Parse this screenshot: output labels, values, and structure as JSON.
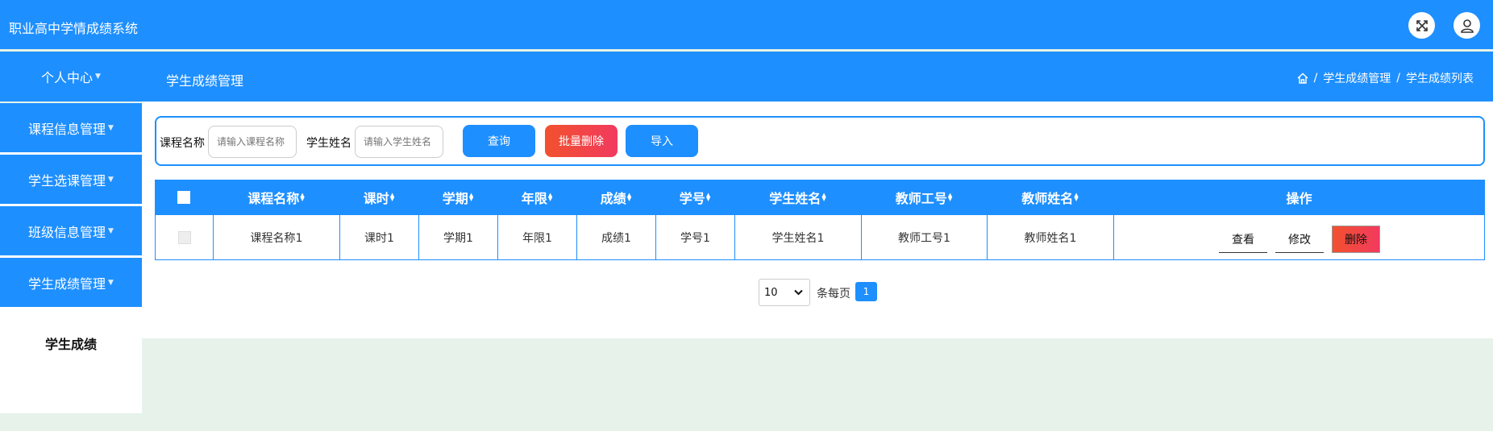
{
  "app": {
    "title": "职业高中学情成绩系统"
  },
  "header": {
    "expand_icon": "expand-arrows-icon",
    "user_icon": "user-icon"
  },
  "subbar": {
    "personal_center": "个人中心",
    "page_title": "学生成绩管理",
    "breadcrumb": [
      "学生成绩管理",
      "学生成绩列表"
    ]
  },
  "sidebar": {
    "items": [
      {
        "label": "课程信息管理"
      },
      {
        "label": "学生选课管理"
      },
      {
        "label": "班级信息管理"
      },
      {
        "label": "学生成绩管理"
      }
    ],
    "active_sub": "学生成绩"
  },
  "search": {
    "course_label": "课程名称",
    "course_placeholder": "请输入课程名称",
    "student_label": "学生姓名",
    "student_placeholder": "请输入学生姓名",
    "query_button": "查询",
    "batch_delete_button": "批量删除",
    "import_button": "导入"
  },
  "table": {
    "columns": [
      "课程名称",
      "课时",
      "学期",
      "年限",
      "成绩",
      "学号",
      "学生姓名",
      "教师工号",
      "教师姓名",
      "操作"
    ],
    "rows": [
      {
        "cells": [
          "课程名称1",
          "课时1",
          "学期1",
          "年限1",
          "成绩1",
          "学号1",
          "学生姓名1",
          "教师工号1",
          "教师姓名1"
        ]
      }
    ],
    "actions": {
      "view": "查看",
      "edit": "修改",
      "delete": "删除"
    }
  },
  "pagination": {
    "page_size": "10",
    "per_page_label": "条每页",
    "current_page": "1"
  },
  "colors": {
    "primary": "#1e8fff",
    "danger": "#f2512e",
    "background": "#e6f2ea"
  }
}
